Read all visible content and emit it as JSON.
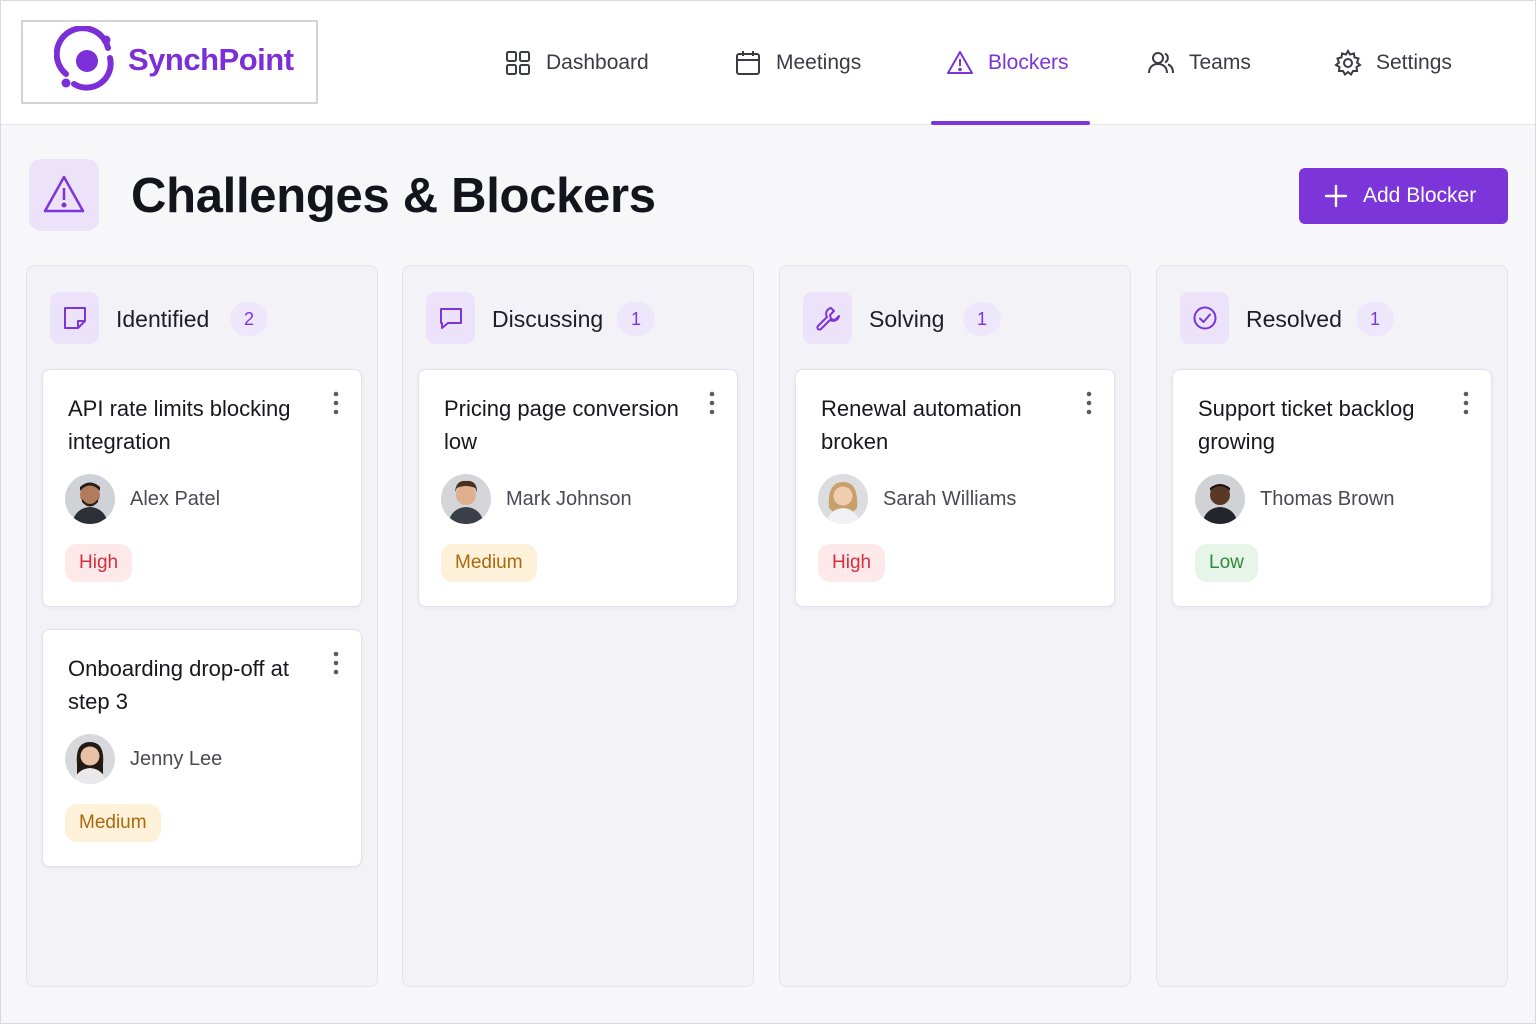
{
  "app": {
    "name": "SynchPoint"
  },
  "nav": [
    {
      "label": "Dashboard",
      "icon": "grid-icon",
      "active": false
    },
    {
      "label": "Meetings",
      "icon": "calendar-icon",
      "active": false
    },
    {
      "label": "Blockers",
      "icon": "warning-icon",
      "active": true
    },
    {
      "label": "Teams",
      "icon": "users-icon",
      "active": false
    },
    {
      "label": "Settings",
      "icon": "gear-icon",
      "active": false
    }
  ],
  "page": {
    "title": "Challenges & Blockers",
    "title_icon": "warning-icon",
    "add_button_label": "Add Blocker"
  },
  "colors": {
    "accent": "#7b35d8",
    "high": "#d32f3f",
    "medium": "#a86a0c",
    "low": "#2e8a3e"
  },
  "columns": [
    {
      "title": "Identified",
      "count": "2",
      "icon": "sticky-note-icon",
      "cards": [
        {
          "title": "API rate limits blocking integration",
          "owner": "Alex Patel",
          "priority": "High"
        },
        {
          "title": "Onboarding drop-off at step 3",
          "owner": "Jenny Lee",
          "priority": "Medium"
        }
      ]
    },
    {
      "title": "Discussing",
      "count": "1",
      "icon": "chat-bubble-icon",
      "cards": [
        {
          "title": "Pricing page conversion low",
          "owner": "Mark Johnson",
          "priority": "Medium"
        }
      ]
    },
    {
      "title": "Solving",
      "count": "1",
      "icon": "wrench-icon",
      "cards": [
        {
          "title": "Renewal automation broken",
          "owner": "Sarah Williams",
          "priority": "High"
        }
      ]
    },
    {
      "title": "Resolved",
      "count": "1",
      "icon": "check-circle-icon",
      "cards": [
        {
          "title": "Support ticket backlog growing",
          "owner": "Thomas Brown",
          "priority": "Low"
        }
      ]
    }
  ]
}
